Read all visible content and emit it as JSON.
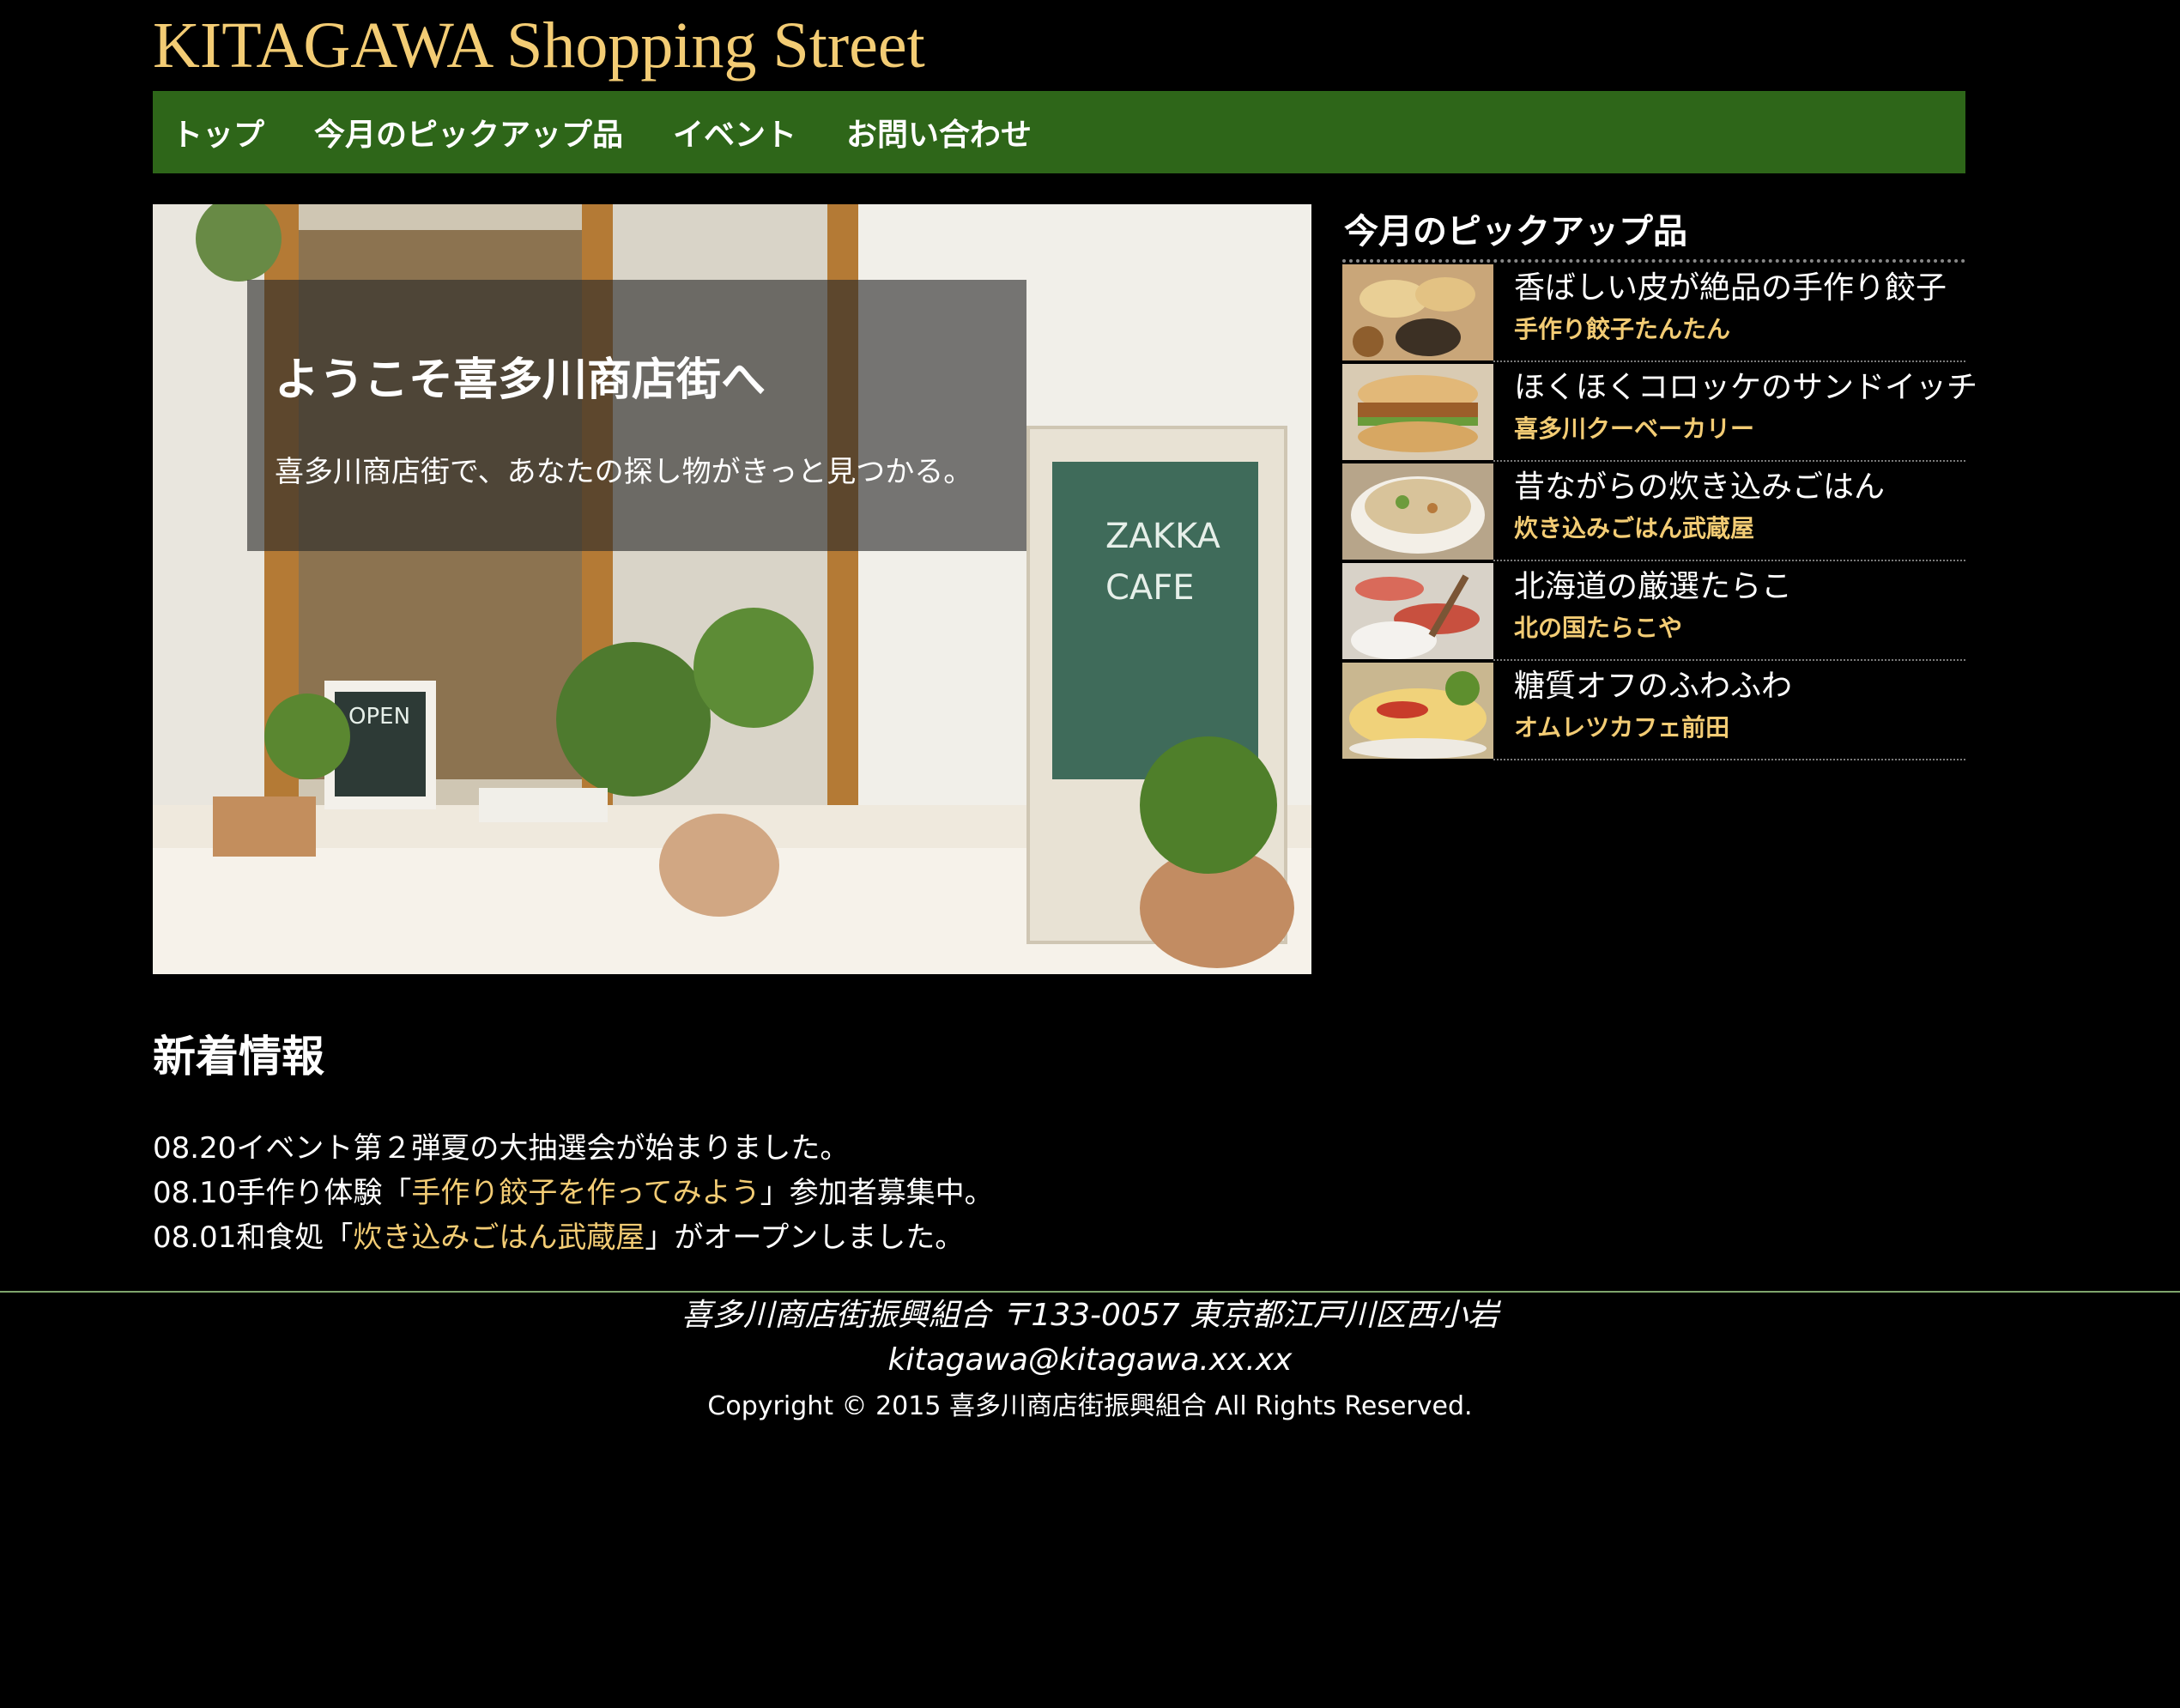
{
  "header": {
    "site_title": "KITAGAWA Shopping Street",
    "nav": [
      "トップ",
      "今月のピックアップ品",
      "イベント",
      "お問い合わせ"
    ]
  },
  "hero": {
    "title": "ようこそ喜多川商店街へ",
    "text": "喜多川商店街で、あなたの探し物がきっと見つかる。"
  },
  "pickup": {
    "title": "今月のピックアップ品",
    "items": [
      {
        "name": "香ばしい皮が絶品の手作り餃子",
        "shop": "手作り餃子たんたん"
      },
      {
        "name": "ほくほくコロッケのサンドイッチ",
        "shop": "喜多川クーベーカリー"
      },
      {
        "name": "昔ながらの炊き込みごはん",
        "shop": "炊き込みごはん武蔵屋"
      },
      {
        "name": "北海道の厳選たらこ",
        "shop": "北の国たらこや"
      },
      {
        "name": "糖質オフのふわふわ",
        "shop": "オムレツカフェ前田"
      }
    ]
  },
  "news": {
    "title": "新着情報",
    "items": [
      {
        "before": "08.20イベント第２弾夏の大抽選会が始まりました。",
        "link": "",
        "after": ""
      },
      {
        "before": "08.10手作り体験「",
        "link": "手作り餃子を作ってみよう",
        "after": "」参加者募集中。"
      },
      {
        "before": "08.01和食処「",
        "link": "炊き込みごはん武蔵屋",
        "after": "」がオープンしました。"
      }
    ]
  },
  "footer": {
    "address": "喜多川商店街振興組合 〒133-0057 東京都江戸川区西小岩",
    "email": "kitagawa@kitagawa.xx.xx",
    "copyright": "Copyright © 2015 喜多川商店街振興組合 All Rights Reserved."
  },
  "colors": {
    "background": "#000000",
    "accent_gold": "#f3cc74",
    "nav_green": "#2e6619"
  }
}
